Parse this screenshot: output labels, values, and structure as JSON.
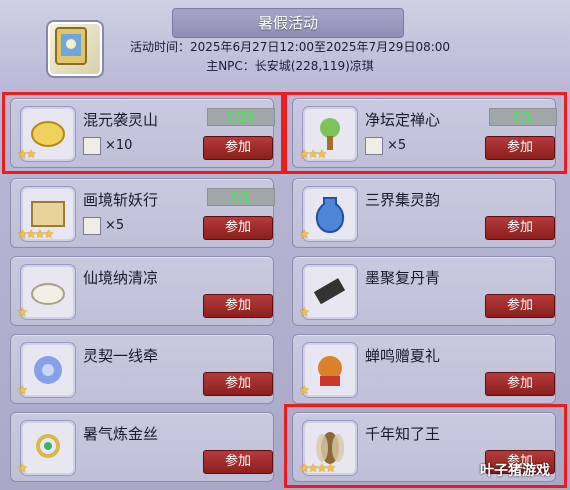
{
  "header": {
    "title": "暑假活动",
    "time_line": "活动时间：2025年6月27日12:00至2025年7月29日08:00",
    "npc_line": "主NPC：长安城(228,119)凉琪"
  },
  "activities": [
    {
      "name": "混元袭灵山",
      "progress": "0/20",
      "reward_count": "×10",
      "stars": "★★",
      "button": "参加"
    },
    {
      "name": "净坛定禅心",
      "progress": "0/1",
      "reward_count": "×5",
      "stars": "★★★",
      "button": "参加"
    },
    {
      "name": "画境斩妖行",
      "progress": "0/1",
      "reward_count": "×5",
      "stars": "★★★★",
      "button": "参加"
    },
    {
      "name": "三界集灵韵",
      "progress": "",
      "reward_count": "",
      "stars": "★",
      "button": "参加"
    },
    {
      "name": "仙境纳清凉",
      "progress": "",
      "reward_count": "",
      "stars": "★",
      "button": "参加"
    },
    {
      "name": "墨聚复丹青",
      "progress": "",
      "reward_count": "",
      "stars": "★",
      "button": "参加"
    },
    {
      "name": "灵契一线牵",
      "progress": "",
      "reward_count": "",
      "stars": "★",
      "button": "参加"
    },
    {
      "name": "蝉鸣赠夏礼",
      "progress": "",
      "reward_count": "",
      "stars": "★",
      "button": "参加"
    },
    {
      "name": "暑气炼金丝",
      "progress": "",
      "reward_count": "",
      "stars": "★",
      "button": "参加"
    },
    {
      "name": "千年知了王",
      "progress": "",
      "reward_count": "",
      "stars": "★★★★",
      "button": "参加"
    }
  ],
  "watermark": "叶子猪游戏",
  "colors": {
    "button": "#9a2626",
    "progress_text": "#3aef4a",
    "highlight": "#ee1d1d",
    "panel": "#bfbfd8"
  }
}
